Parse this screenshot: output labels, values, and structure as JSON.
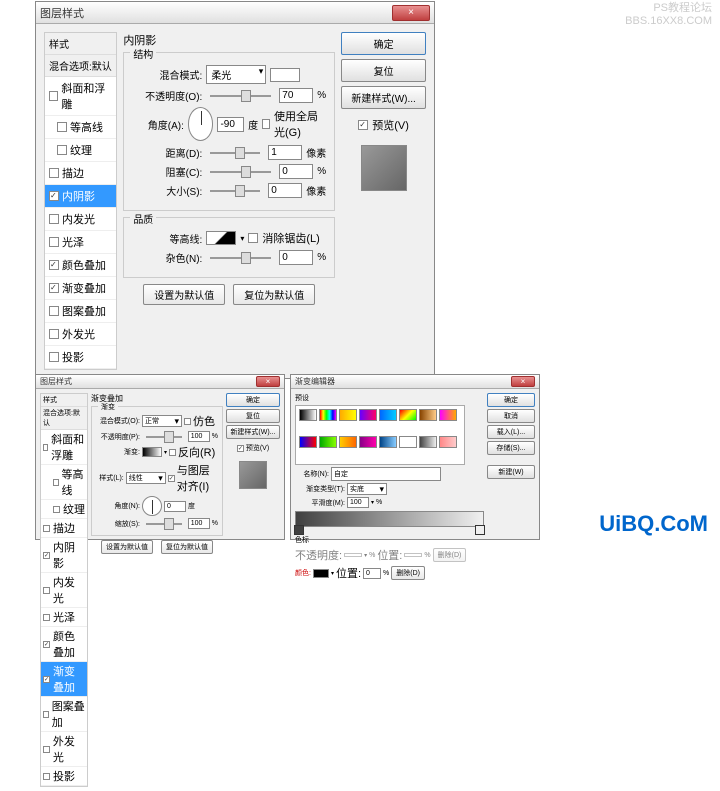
{
  "watermark": {
    "l1": "PS教程论坛",
    "l2": "BBS.16XX8.COM"
  },
  "ubq": "UiBQ.CoM",
  "main": {
    "title": "图层样式",
    "styles_header": "样式",
    "blend_opts": "混合选项:默认",
    "items": [
      {
        "label": "斜面和浮雕",
        "on": false
      },
      {
        "label": "等高线",
        "on": false,
        "indent": true
      },
      {
        "label": "纹理",
        "on": false,
        "indent": true
      },
      {
        "label": "描边",
        "on": false
      },
      {
        "label": "内阴影",
        "on": true,
        "sel": true
      },
      {
        "label": "内发光",
        "on": false
      },
      {
        "label": "光泽",
        "on": false
      },
      {
        "label": "颜色叠加",
        "on": true
      },
      {
        "label": "渐变叠加",
        "on": true
      },
      {
        "label": "图案叠加",
        "on": false
      },
      {
        "label": "外发光",
        "on": false
      },
      {
        "label": "投影",
        "on": false
      }
    ],
    "panel_title": "内阴影",
    "g1": "结构",
    "blend_mode_lbl": "混合模式:",
    "blend_mode_val": "柔光",
    "opacity_lbl": "不透明度(O):",
    "opacity_val": "70",
    "pct": "%",
    "angle_lbl": "角度(A):",
    "angle_val": "-90",
    "deg": "度",
    "global_light": "使用全局光(G)",
    "dist_lbl": "距离(D):",
    "dist_val": "1",
    "px": "像素",
    "choke_lbl": "阻塞(C):",
    "choke_val": "0",
    "size_lbl": "大小(S):",
    "size_val": "0",
    "g2": "品质",
    "contour_lbl": "等高线:",
    "antialias": "消除锯齿(L)",
    "noise_lbl": "杂色(N):",
    "noise_val": "0",
    "make_default": "设置为默认值",
    "reset_default": "复位为默认值",
    "ok": "确定",
    "cancel": "复位",
    "new_style": "新建样式(W)...",
    "preview": "预览(V)"
  },
  "sm1": {
    "title": "图层样式",
    "panel_title": "渐变叠加",
    "g1": "渐变",
    "blend_mode_lbl": "混合模式(O):",
    "blend_mode_val": "正常",
    "dither": "仿色",
    "opacity_lbl": "不透明度(P):",
    "opacity_val": "100",
    "grad_lbl": "渐变:",
    "reverse": "反向(R)",
    "style_lbl": "样式(L):",
    "style_val": "线性",
    "align": "与图层对齐(I)",
    "angle_lbl": "角度(N):",
    "angle_val": "0",
    "scale_lbl": "缩放(S):",
    "scale_val": "100",
    "sel_item": "渐变叠加"
  },
  "ge": {
    "title": "渐变编辑器",
    "presets": "预设",
    "name_lbl": "名称(N):",
    "name_val": "自定",
    "type_lbl": "渐变类型(T):",
    "type_val": "实底",
    "smooth_lbl": "平滑度(M):",
    "smooth_val": "100",
    "stops": "色标",
    "opacity_lbl": "不透明度:",
    "loc_lbl": "位置:",
    "color_lbl": "颜色:",
    "loc_val": "0",
    "delete": "删除(D)",
    "ok": "确定",
    "cancel": "取消",
    "load": "载入(L)...",
    "save": "存储(S)...",
    "new": "新建(W)",
    "gp": [
      "linear-gradient(90deg,#000,#fff)",
      "linear-gradient(90deg,#f00,#ff0,#0f0,#0ff,#00f,#f0f)",
      "linear-gradient(90deg,#fa0,#ff0)",
      "linear-gradient(90deg,#60f,#f06)",
      "linear-gradient(90deg,#06f,#0cf)",
      "linear-gradient(135deg,#f00,#ff0,#0f0)",
      "linear-gradient(90deg,#840,#fc8)",
      "linear-gradient(90deg,#f0f,#fa0)",
      "linear-gradient(90deg,#00f,#f00)",
      "linear-gradient(90deg,#0a0,#8f0)",
      "linear-gradient(90deg,#fc0,#f60)",
      "linear-gradient(90deg,#808,#f0a)",
      "linear-gradient(90deg,#048,#8cf)",
      "linear-gradient(90deg,#fff,#fff)",
      "linear-gradient(90deg,#444,#eee)",
      "linear-gradient(90deg,#f88,#fcc)"
    ]
  }
}
